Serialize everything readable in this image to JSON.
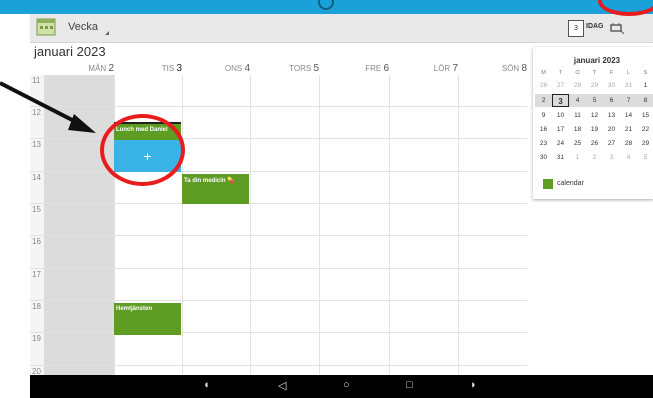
{
  "toolbar": {
    "view_label": "Vecka",
    "today_number": "3",
    "today_label": "IDAG"
  },
  "month_title": "januari 2023",
  "day_headers": [
    {
      "dow": "MÅN",
      "num": "2"
    },
    {
      "dow": "TIS",
      "num": "3"
    },
    {
      "dow": "ONS",
      "num": "4"
    },
    {
      "dow": "TORS",
      "num": "5"
    },
    {
      "dow": "FRE",
      "num": "6"
    },
    {
      "dow": "LÖR",
      "num": "7"
    },
    {
      "dow": "SÖN",
      "num": "8"
    }
  ],
  "hours": [
    "11",
    "12",
    "13",
    "14",
    "15",
    "16",
    "17",
    "18",
    "19",
    "20"
  ],
  "events": {
    "lunch": "Lunch med Daniel",
    "medicine": "Ta din medicin 💊",
    "homecare": "Hemtjänsten"
  },
  "new_event_symbol": "+",
  "mini_calendar": {
    "title": "januari 2023",
    "dow": [
      "M",
      "T",
      "O",
      "T",
      "F",
      "L",
      "S"
    ],
    "weeks": [
      [
        "26",
        "27",
        "28",
        "29",
        "30",
        "31",
        "1"
      ],
      [
        "2",
        "3",
        "4",
        "5",
        "6",
        "7",
        "8"
      ],
      [
        "9",
        "10",
        "11",
        "12",
        "13",
        "14",
        "15"
      ],
      [
        "16",
        "17",
        "18",
        "19",
        "20",
        "21",
        "22"
      ],
      [
        "23",
        "24",
        "25",
        "26",
        "27",
        "28",
        "29"
      ],
      [
        "30",
        "31",
        "1",
        "2",
        "3",
        "4",
        "5"
      ]
    ],
    "legend_label": "calendar"
  },
  "colors": {
    "accent": "#1aa2d8",
    "event_green": "#5e9c23",
    "new_slot_blue": "#39b3e6",
    "annotation_red": "#e81c1c"
  }
}
